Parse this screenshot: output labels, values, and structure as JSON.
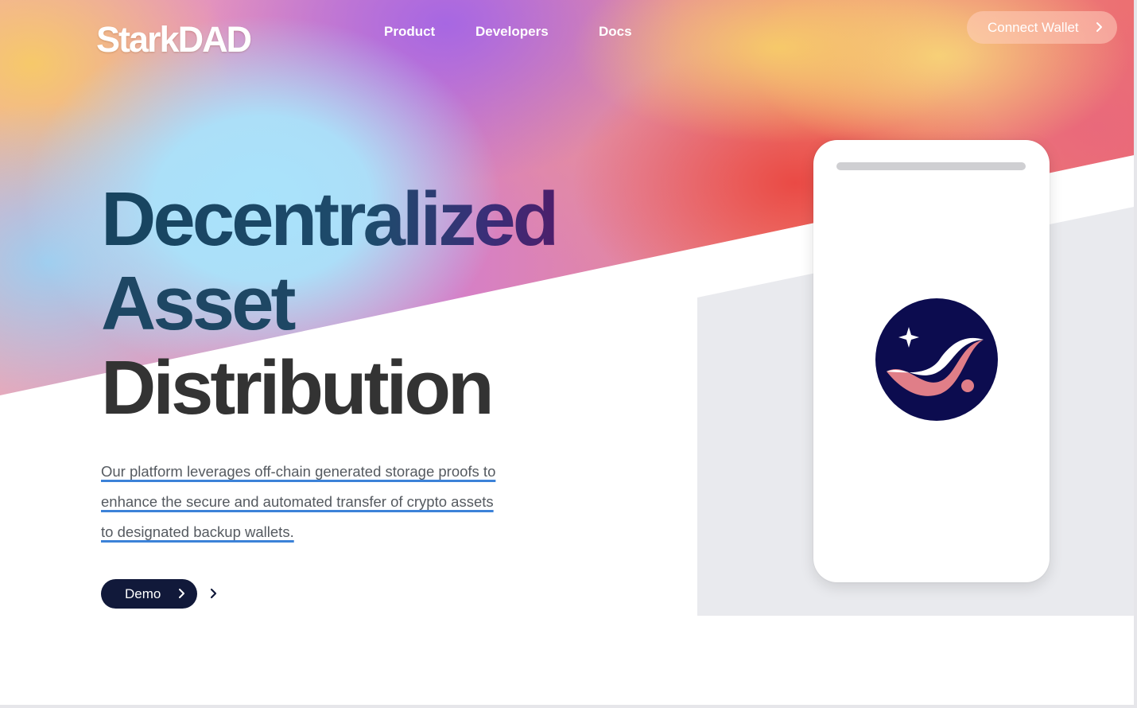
{
  "brand": {
    "logo_text": "StarkDAD"
  },
  "nav": {
    "links": [
      "Product",
      "Developers",
      "Docs"
    ],
    "connect_wallet_label": "Connect Wallet"
  },
  "hero": {
    "headline_lines": [
      "Decentralized",
      "Asset",
      "Distribution"
    ],
    "description_lines": [
      "Our platform leverages off-chain generated storage proofs to",
      "enhance the secure and automated transfer of crypto assets",
      "to designated backup wallets."
    ],
    "demo_label": "Demo"
  },
  "phone": {
    "logo_icon": "starknet-logo-icon"
  },
  "colors": {
    "headline_blue": "#1e4764",
    "headline_dark": "#333333",
    "demo_button": "#11193a",
    "underline": "#3c82d8",
    "logo_circle": "#0c0c4f",
    "logo_accent": "#e07e88"
  }
}
